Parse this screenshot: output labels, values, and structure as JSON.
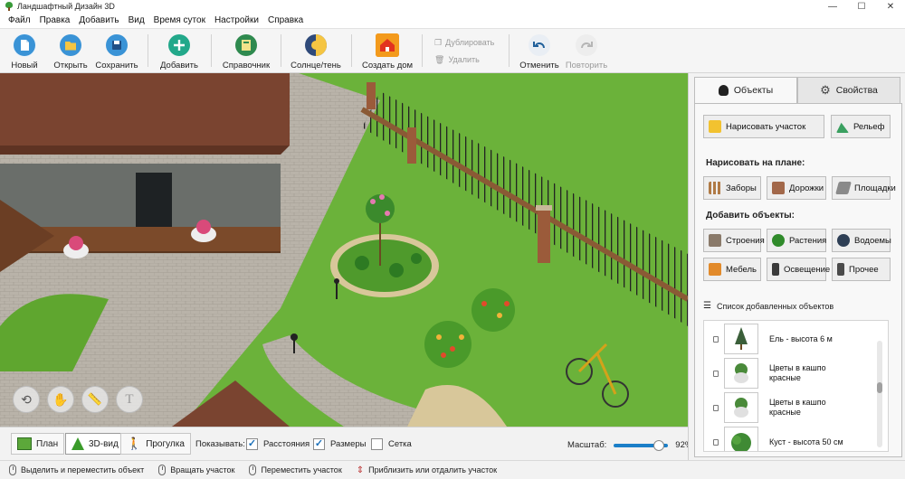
{
  "window": {
    "title": "Ландшафтный Дизайн 3D",
    "controls": [
      "—",
      "☐",
      "✕"
    ]
  },
  "menu": [
    "Файл",
    "Правка",
    "Добавить",
    "Вид",
    "Время суток",
    "Настройки",
    "Справка"
  ],
  "toolbar": {
    "new": "Новый",
    "open": "Открыть",
    "save": "Сохранить",
    "add": "Добавить",
    "reference": "Справочник",
    "sun_shadow": "Солнце/тень",
    "create_house": "Создать дом",
    "duplicate": "Дублировать",
    "delete": "Удалить",
    "undo": "Отменить",
    "redo": "Повторить"
  },
  "viewport_tools": {
    "text_glyph": "T"
  },
  "view_modes": {
    "plan": "План",
    "view3d": "3D-вид",
    "walk": "Прогулка"
  },
  "display": {
    "label": "Показывать:",
    "distances": {
      "label": "Расстояния",
      "checked": true
    },
    "sizes": {
      "label": "Размеры",
      "checked": true
    },
    "grid": {
      "label": "Сетка",
      "checked": false
    }
  },
  "zoom": {
    "label": "Масштаб:",
    "value": "92%",
    "fraction": 0.92
  },
  "status": {
    "select": "Выделить и переместить объект",
    "rotate": "Вращать участок",
    "move": "Переместить участок",
    "zoom": "Приблизить или отдалить участок"
  },
  "panel": {
    "tabs": {
      "objects": "Объекты",
      "properties": "Свойства"
    },
    "draw_plot": "Нарисовать участок",
    "relief": "Рельеф",
    "draw_on_plan_title": "Нарисовать на плане:",
    "draw_items": [
      "Заборы",
      "Дорожки",
      "Площадки"
    ],
    "add_objects_title": "Добавить объекты:",
    "add_items": [
      "Строения",
      "Растения",
      "Водоемы",
      "Мебель",
      "Освещение",
      "Прочее"
    ],
    "list_title": "Список добавленных объектов",
    "objects": [
      {
        "name": "Ель - высота 6 м"
      },
      {
        "name": "Цветы в кашпо красные"
      },
      {
        "name": "Цветы в кашпо красные"
      },
      {
        "name": "Куст - высота 50 см"
      }
    ]
  },
  "colors": {
    "accent": "#1b7fc8",
    "grass": "#6bb23a",
    "roof": "#7a4430",
    "paving": "#b8b2a8"
  }
}
